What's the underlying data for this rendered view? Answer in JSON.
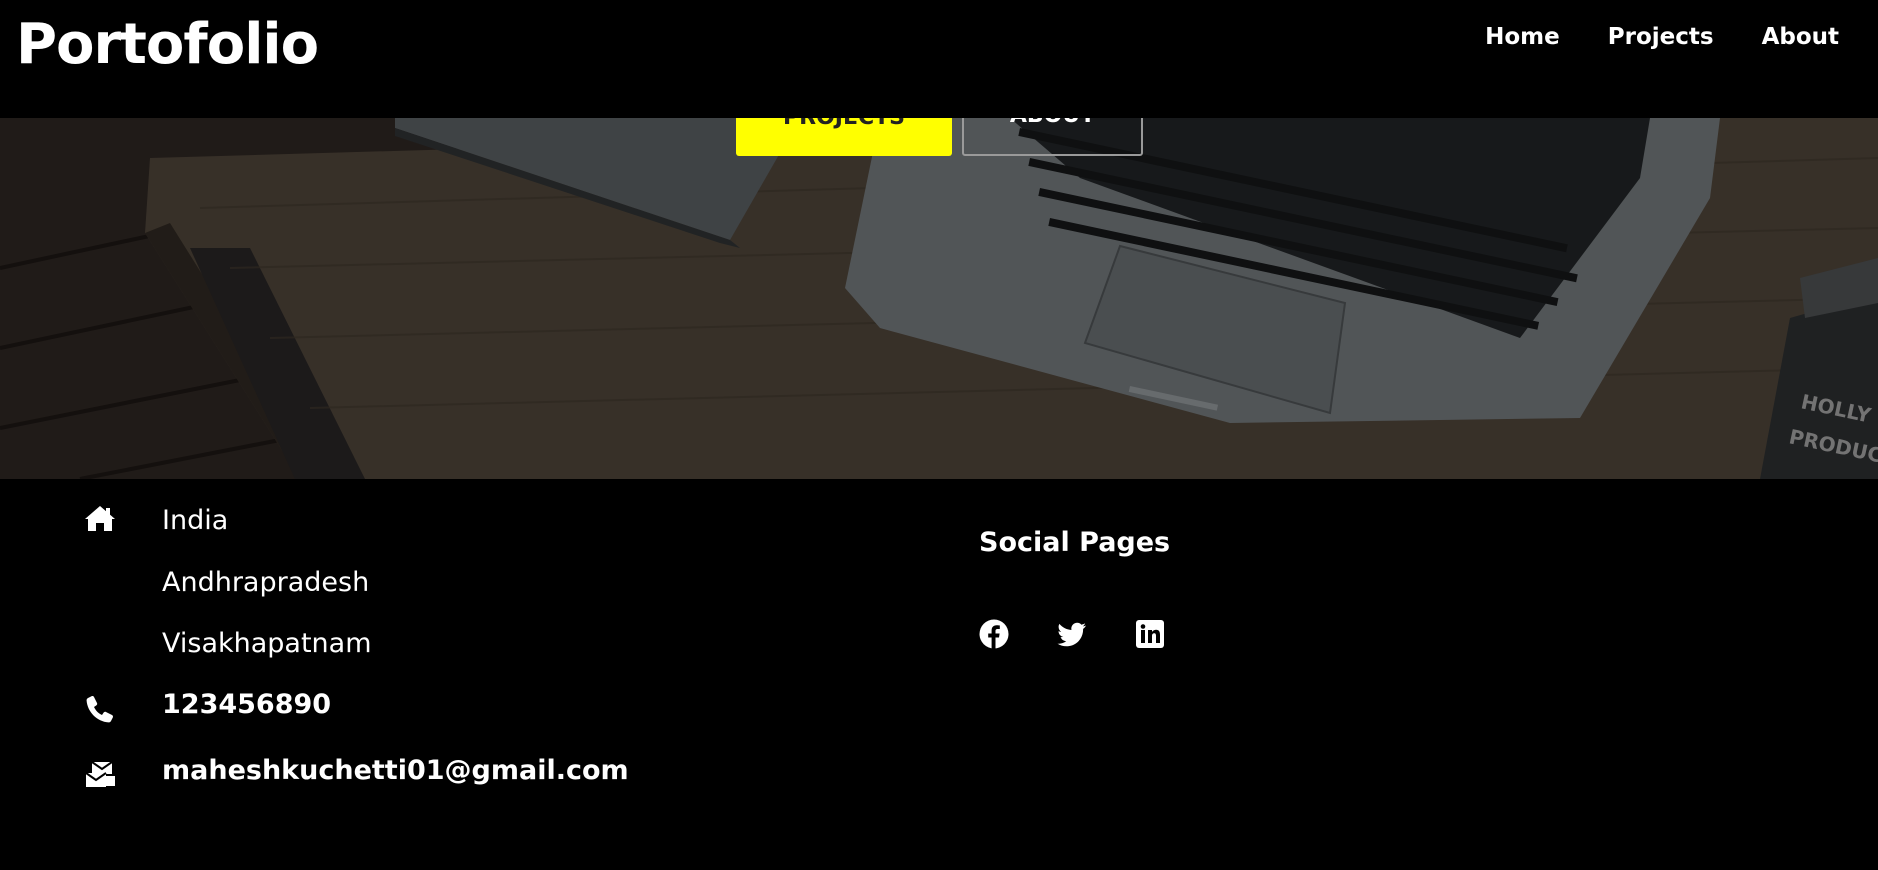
{
  "header": {
    "logo": "Portofolio",
    "nav": [
      "Home",
      "Projects",
      "About"
    ]
  },
  "hero": {
    "projects_label": "PROJECTS",
    "about_label": "ABOUT",
    "accent": "#ffff00"
  },
  "contact": {
    "address": [
      "India",
      "Andhrapradesh",
      "Visakhapatnam"
    ],
    "phone": "123456890",
    "email": "maheshkuchetti01@gmail.com"
  },
  "social": {
    "title": "Social Pages",
    "icons": [
      "facebook-icon",
      "twitter-icon",
      "linkedin-icon"
    ]
  }
}
